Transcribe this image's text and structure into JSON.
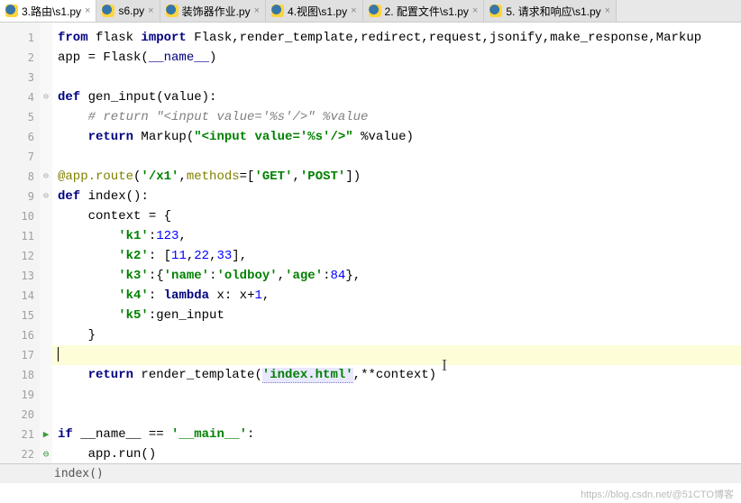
{
  "tabs": [
    {
      "label": "3.路由\\s1.py",
      "active": true
    },
    {
      "label": "s6.py",
      "active": false
    },
    {
      "label": "装饰器作业.py",
      "active": false
    },
    {
      "label": "4.视图\\s1.py",
      "active": false
    },
    {
      "label": "2. 配置文件\\s1.py",
      "active": false
    },
    {
      "label": "5. 请求和响应\\s1.py",
      "active": false
    }
  ],
  "gutter": [
    "1",
    "2",
    "3",
    "4",
    "5",
    "6",
    "7",
    "8",
    "9",
    "10",
    "11",
    "12",
    "13",
    "14",
    "15",
    "16",
    "17",
    "18",
    "19",
    "20",
    "21",
    "22"
  ],
  "fold_marks": {
    "4": "⊖",
    "8": "⊖",
    "9": "⊖",
    "21": "▶ ⊖"
  },
  "code": {
    "l1_from": "from",
    "l1_flask": " flask ",
    "l1_import": "import",
    "l1_rest": " Flask,render_template,redirect,request,jsonify,make_response,Markup",
    "l2_a": "app = Flask(",
    "l2_b": "__name__",
    "l2_c": ")",
    "l4_def": "def",
    "l4_name": " gen_input",
    "l4_sig": "(value):",
    "l5": "    # return \"<input value='%s'/>\" %value",
    "l6_ret": "    return",
    "l6_mk": " Markup(",
    "l6_str": "\"<input value='%s'/>\"",
    "l6_end": " %value)",
    "l8_dec": "@app.route",
    "l8_p1": "(",
    "l8_s1": "'/x1'",
    "l8_c": ",",
    "l8_m": "methods",
    "l8_eq": "=[",
    "l8_g": "'GET'",
    "l8_c2": ",",
    "l8_p": "'POST'",
    "l8_end": "])",
    "l9_def": "def",
    "l9_name": " index",
    "l9_sig": "():",
    "l10": "    context = {",
    "l11_k": "        'k1'",
    "l11_c": ":",
    "l11_v": "123",
    "l11_e": ",",
    "l12_k": "        'k2'",
    "l12_c": ": [",
    "l12_v1": "11",
    "l12_s1": ",",
    "l12_v2": "22",
    "l12_s2": ",",
    "l12_v3": "33",
    "l12_e": "],",
    "l13_k": "        'k3'",
    "l13_c": ":{",
    "l13_nk": "'name'",
    "l13_nc": ":",
    "l13_nv": "'oldboy'",
    "l13_s": ",",
    "l13_ak": "'age'",
    "l13_ac": ":",
    "l13_av": "84",
    "l13_e": "},",
    "l14_k": "        'k4'",
    "l14_c": ": ",
    "l14_l": "lambda",
    "l14_r": " x: x+",
    "l14_n": "1",
    "l14_e": ",",
    "l15_k": "        'k5'",
    "l15_c": ":gen_input",
    "l16": "    }",
    "l18_ret": "    return",
    "l18_fn": " render_template(",
    "l18_str": "'index.html'",
    "l18_end": ",**context)",
    "l21_if": "if",
    "l21_n": " __name__ == ",
    "l21_s": "'__main__'",
    "l21_e": ":",
    "l22": "    app.run()"
  },
  "status_text": "index()",
  "watermark": "https://blog.csdn.net/@51CTO博客"
}
